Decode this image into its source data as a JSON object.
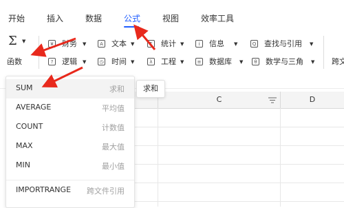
{
  "tabs": [
    "开始",
    "插入",
    "数据",
    "公式",
    "视图",
    "效率工具"
  ],
  "active_tab": "公式",
  "fx_button": {
    "icon": "sigma-icon",
    "symbol": "Σ",
    "label": "函数"
  },
  "ribbon_row1": [
    {
      "icon": "finance-icon",
      "glyph": "¥",
      "label": "财务"
    },
    {
      "icon": "text-icon",
      "glyph": "A",
      "label": "文本"
    },
    {
      "icon": "statistics-icon",
      "glyph": "Σ",
      "label": "统计"
    },
    {
      "icon": "info-icon",
      "glyph": "i",
      "label": "信息"
    },
    {
      "icon": "lookup-icon",
      "glyph": "Q",
      "label": "查找与引用"
    }
  ],
  "ribbon_row2": [
    {
      "icon": "logic-icon",
      "glyph": "?",
      "label": "逻辑"
    },
    {
      "icon": "time-icon",
      "glyph": "◷",
      "label": "时间"
    },
    {
      "icon": "engineering-icon",
      "glyph": "λ",
      "label": "工程"
    },
    {
      "icon": "database-icon",
      "glyph": "≡",
      "label": "数据库"
    },
    {
      "icon": "math-icon",
      "glyph": "θ",
      "label": "数学与三角"
    }
  ],
  "ribbon_cutoff_label": "跨文",
  "columns": [
    "C",
    "D"
  ],
  "dropdown_items": [
    {
      "name": "SUM",
      "desc": "求和"
    },
    {
      "name": "AVERAGE",
      "desc": "平均值"
    },
    {
      "name": "COUNT",
      "desc": "计数值"
    },
    {
      "name": "MAX",
      "desc": "最大值"
    },
    {
      "name": "MIN",
      "desc": "最小值"
    },
    {
      "name": "IMPORTRANGE",
      "desc": "跨文件引用"
    }
  ],
  "tooltip": "求和",
  "colors": {
    "accent": "#1e5cff",
    "annotation_arrow": "#e8291c"
  }
}
